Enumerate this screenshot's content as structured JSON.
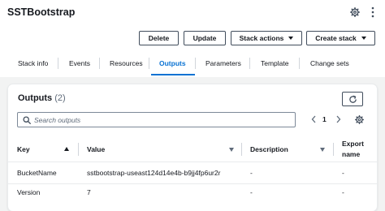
{
  "header": {
    "title": "SSTBootstrap"
  },
  "actions": {
    "delete": "Delete",
    "update": "Update",
    "stack_actions": "Stack actions",
    "create_stack": "Create stack"
  },
  "tabs": [
    {
      "label": "Stack info"
    },
    {
      "label": "Events"
    },
    {
      "label": "Resources"
    },
    {
      "label": "Outputs",
      "active": true
    },
    {
      "label": "Parameters"
    },
    {
      "label": "Template"
    },
    {
      "label": "Change sets"
    }
  ],
  "outputs": {
    "heading": "Outputs",
    "count": "(2)",
    "search_placeholder": "Search outputs",
    "page": "1",
    "columns": {
      "key": "Key",
      "value": "Value",
      "description": "Description",
      "export_line1": "Export",
      "export_line2": "name"
    },
    "rows": [
      {
        "key": "BucketName",
        "value": "sstbootstrap-useast124d14e4b-b9jj4fp6ur2r",
        "description": "-",
        "export": "-"
      },
      {
        "key": "Version",
        "value": "7",
        "description": "-",
        "export": "-"
      }
    ]
  },
  "colors": {
    "accent": "#0972d3",
    "text": "#16191f",
    "border": "#414d5c",
    "background": "#f2f3f3"
  },
  "icons": [
    "settings-icon",
    "more-vertical-icon",
    "caret-down-icon",
    "refresh-icon",
    "search-icon",
    "chevron-left-icon",
    "chevron-right-icon",
    "sort-ascending-icon",
    "sort-icon"
  ]
}
